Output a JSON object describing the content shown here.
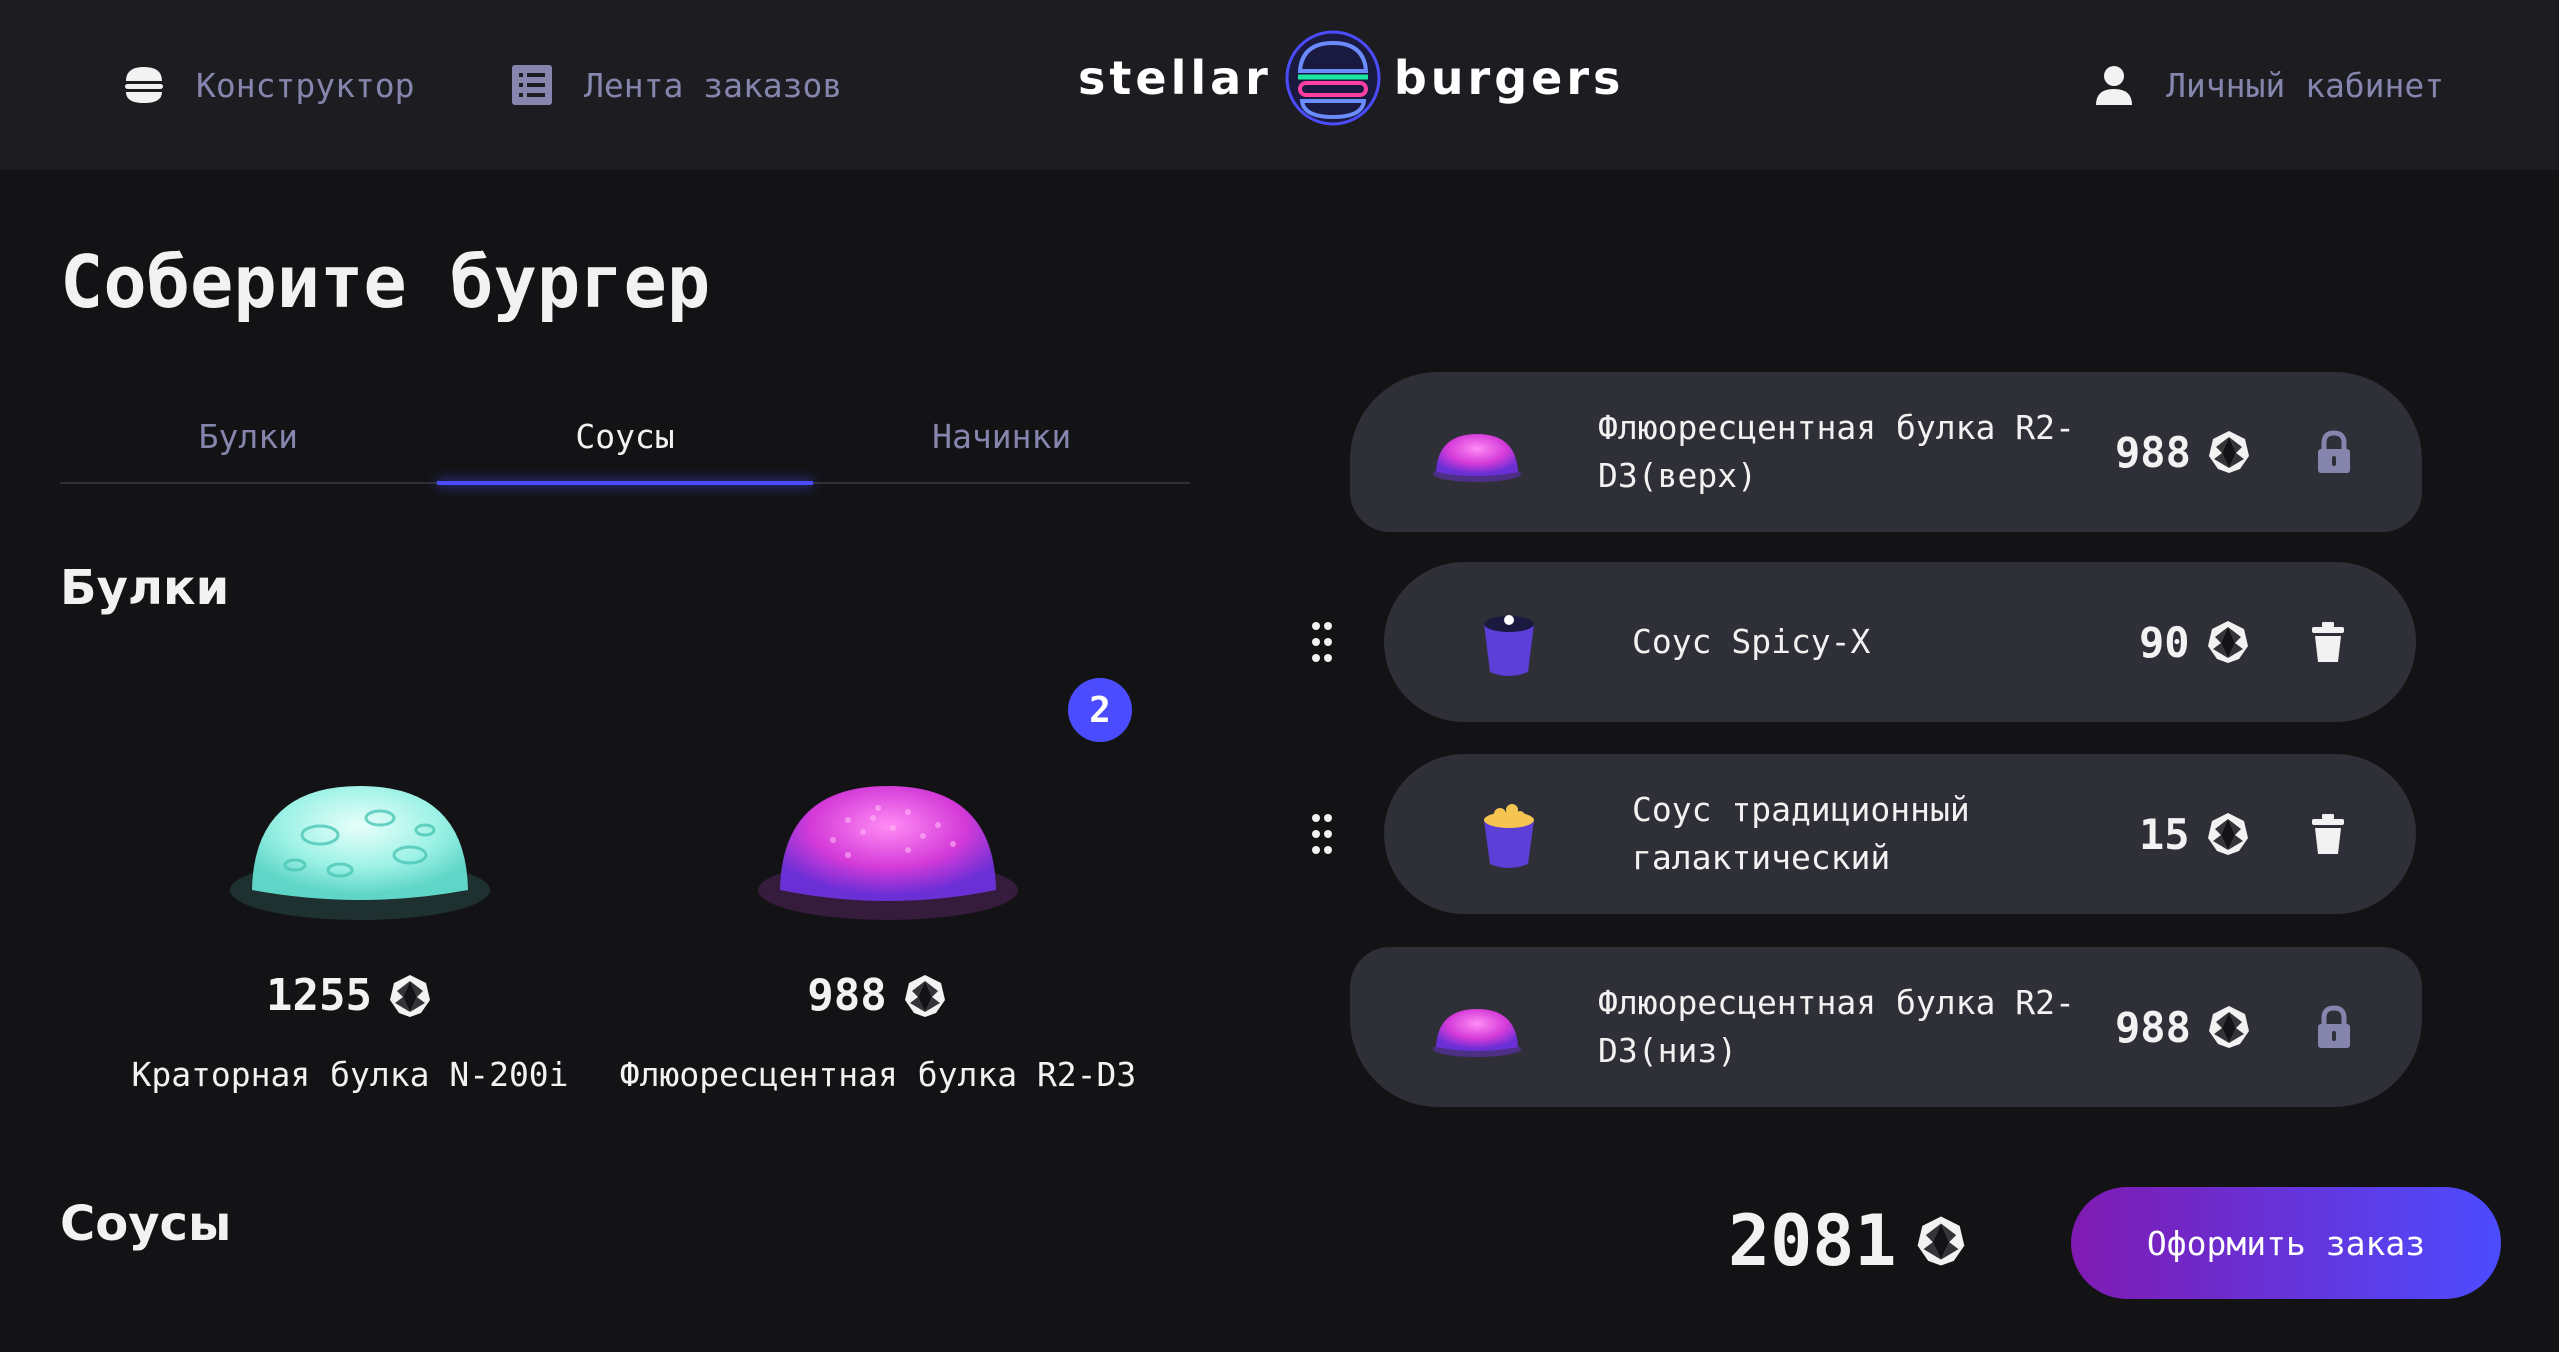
{
  "header": {
    "nav": {
      "constructor": "Конструктор",
      "feed": "Лента заказов",
      "account": "Личный кабинет"
    },
    "logo": {
      "left": "stellar",
      "right": "burgers"
    }
  },
  "main": {
    "title": "Соберите бургер",
    "tabs": [
      "Булки",
      "Соусы",
      "Начинки"
    ],
    "active_tab": "Соусы",
    "sections": {
      "buns_title": "Булки",
      "sauces_title": "Соусы"
    },
    "buns": [
      {
        "name": "Краторная булка N-200i",
        "price": "1255",
        "count": null,
        "color": "#8ff7e8"
      },
      {
        "name": "Флюоресцентная булка R2-D3",
        "price": "988",
        "count": "2",
        "color": "#e04ce0"
      }
    ]
  },
  "constructor": {
    "top": {
      "name": "Флюоресцентная булка R2-D3(верх)",
      "price": "988"
    },
    "fillings": [
      {
        "name": "Соус Spicy-X",
        "price": "90"
      },
      {
        "name": "Соус традиционный галактический",
        "price": "15"
      }
    ],
    "bottom": {
      "name": "Флюоресцентная булка R2-D3(низ)",
      "price": "988"
    },
    "total": "2081",
    "order_button": "Оформить заказ"
  },
  "colors": {
    "accent": "#4c4cff",
    "background": "#131316",
    "card": "#2f2f37",
    "inactive_text": "#8585ad"
  },
  "icons": {
    "constructor": "burger-icon",
    "feed": "list-icon",
    "account": "profile-icon",
    "currency": "currency-icon",
    "lock": "lock-icon",
    "delete": "delete-icon",
    "drag": "drag-icon"
  }
}
